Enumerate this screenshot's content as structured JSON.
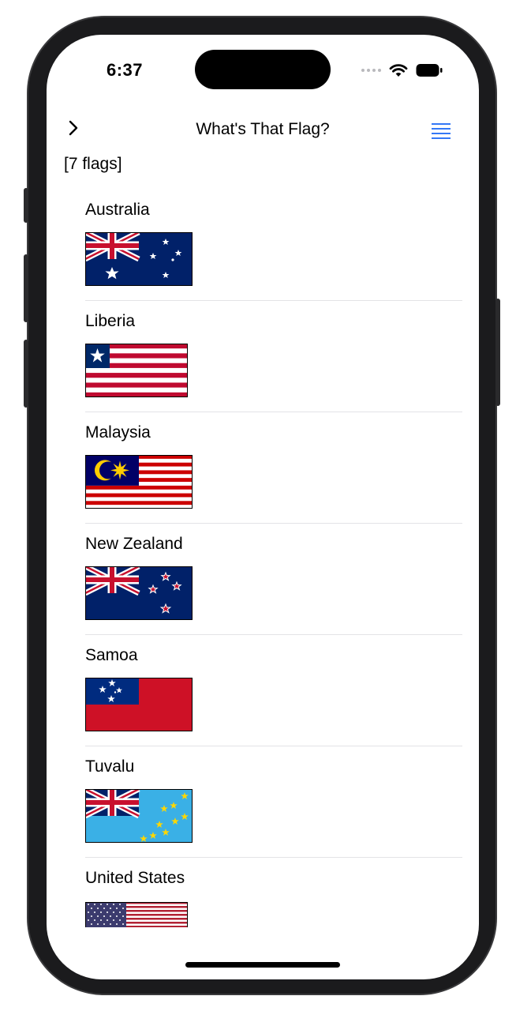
{
  "status_bar": {
    "time": "6:37"
  },
  "nav": {
    "title": "What's That Flag?",
    "back_icon": "chevron-right-icon",
    "menu_icon": "list-icon"
  },
  "summary": {
    "count_label": "[7 flags]"
  },
  "flags": [
    {
      "name": "Australia",
      "flag": "australia"
    },
    {
      "name": "Liberia",
      "flag": "liberia"
    },
    {
      "name": "Malaysia",
      "flag": "malaysia"
    },
    {
      "name": "New Zealand",
      "flag": "new-zealand"
    },
    {
      "name": "Samoa",
      "flag": "samoa"
    },
    {
      "name": "Tuvalu",
      "flag": "tuvalu"
    },
    {
      "name": "United States",
      "flag": "united-states"
    }
  ],
  "colors": {
    "accent": "#3478f6",
    "divider": "#e3e3e6",
    "flag_blue": "#012169",
    "flag_red": "#c8102e"
  }
}
